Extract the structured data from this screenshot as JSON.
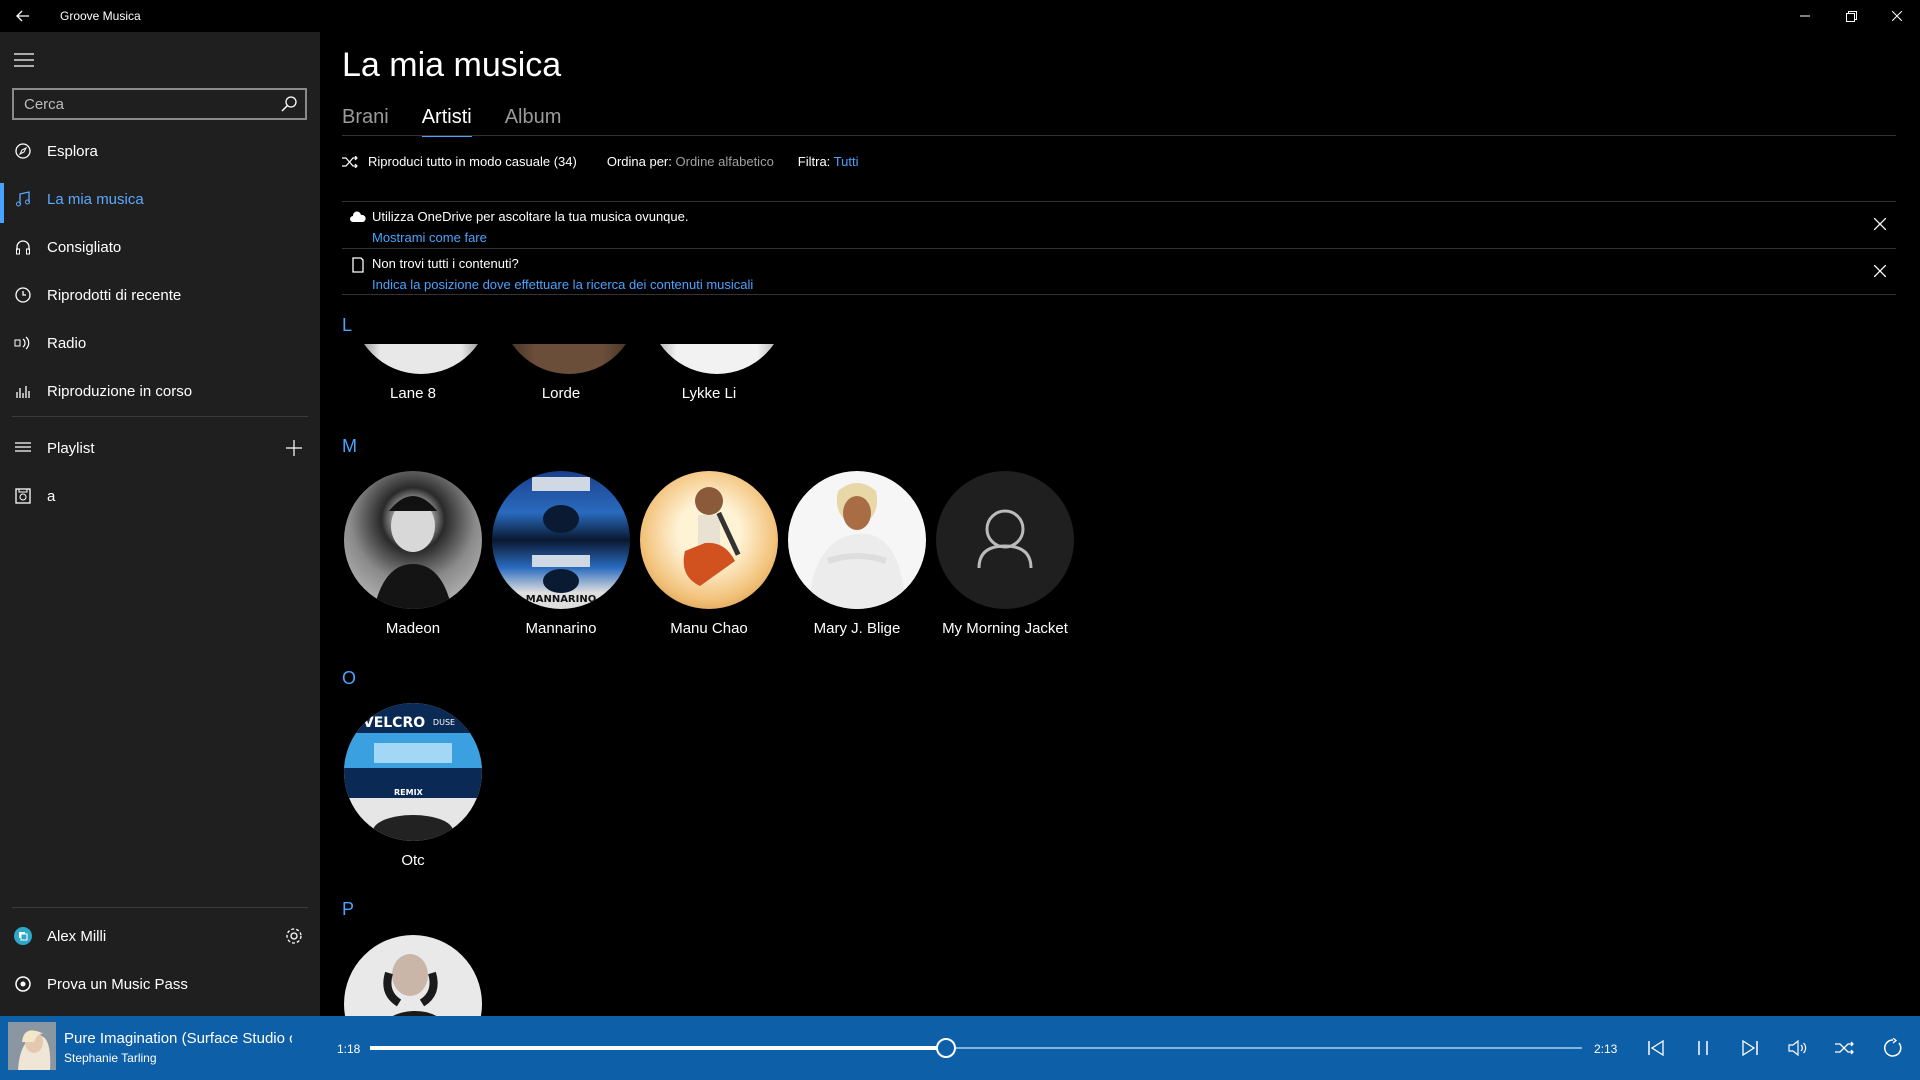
{
  "window": {
    "title": "Groove Musica"
  },
  "sidebar": {
    "search_placeholder": "Cerca",
    "items": [
      {
        "label": "Esplora",
        "icon": "explore-icon"
      },
      {
        "label": "La mia musica",
        "icon": "music-note-icon",
        "active": true
      },
      {
        "label": "Consigliato",
        "icon": "headphones-icon"
      },
      {
        "label": "Riprodotti di recente",
        "icon": "clock-icon"
      },
      {
        "label": "Radio",
        "icon": "radio-icon"
      },
      {
        "label": "Riproduzione in corso",
        "icon": "equalizer-icon"
      }
    ],
    "playlist_label": "Playlist",
    "playlists": [
      {
        "label": "a"
      }
    ],
    "user_name": "Alex Milli",
    "music_pass_label": "Prova un Music Pass"
  },
  "main": {
    "title": "La mia musica",
    "tabs": [
      {
        "label": "Brani"
      },
      {
        "label": "Artisti",
        "active": true
      },
      {
        "label": "Album"
      }
    ],
    "commands": {
      "shuffle_label": "Riproduci tutto in modo casuale (34)",
      "sort_label": "Ordina per:",
      "sort_value": "Ordine alfabetico",
      "filter_label": "Filtra:",
      "filter_value": "Tutti"
    },
    "notices": [
      {
        "text": "Utilizza OneDrive per ascoltare la tua musica ovunque.",
        "link": "Mostrami come fare"
      },
      {
        "text": "Non trovi tutti i contenuti?",
        "link": "Indica la posizione dove effettuare la ricerca dei contenuti musicali"
      }
    ],
    "groups": [
      {
        "letter": "L",
        "artists": [
          "Lane 8",
          "Lorde",
          "Lykke Li"
        ]
      },
      {
        "letter": "M",
        "artists": [
          "Madeon",
          "Mannarino",
          "Manu Chao",
          "Mary J. Blige",
          "My Morning Jacket"
        ]
      },
      {
        "letter": "O",
        "artists": [
          "Otc"
        ]
      },
      {
        "letter": "P",
        "artists": [
          ""
        ]
      }
    ],
    "artwork_texts": {
      "mannarino": "MANNARINO",
      "otc_brand": "VELCRO",
      "otc_sub": "DUSE",
      "otc_remix": "REMIX"
    }
  },
  "player": {
    "title": "Pure Imagination (Surface Studio c",
    "artist": "Stephanie Tarling",
    "current_time": "1:18",
    "total_time": "2:13",
    "progress": 0.475,
    "accent": "#0d5fa8"
  }
}
